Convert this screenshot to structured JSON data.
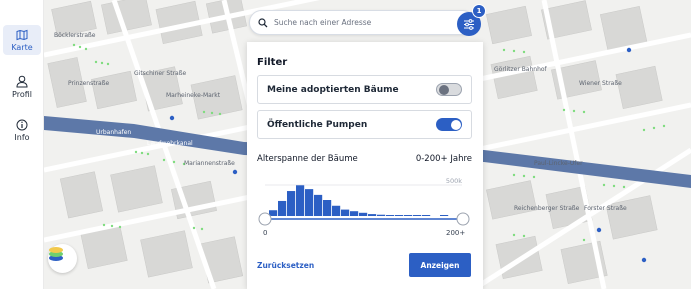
{
  "sidebar": {
    "items": [
      {
        "label": "Karte",
        "icon": "map-icon",
        "active": true
      },
      {
        "label": "Profil",
        "icon": "user-icon",
        "active": false
      },
      {
        "label": "Info",
        "icon": "info-icon",
        "active": false
      }
    ]
  },
  "search": {
    "placeholder": "Suche nach einer Adresse"
  },
  "filter_button": {
    "badge": "1"
  },
  "filter_panel": {
    "title": "Filter",
    "toggles": [
      {
        "label": "Meine adoptierten Bäume",
        "on": false
      },
      {
        "label": "Öffentliche Pumpen",
        "on": true
      }
    ],
    "age_label": "Alterspanne der Bäume",
    "age_range": "0-200+ Jahre",
    "histogram": {
      "max_label": "500k",
      "min_tick": "0",
      "max_tick": "200+",
      "bins": [
        0.18,
        0.47,
        0.78,
        0.96,
        0.84,
        0.66,
        0.5,
        0.32,
        0.2,
        0.15,
        0.1,
        0.06,
        0.04,
        0.03,
        0.02,
        0.02,
        0.01,
        0.02,
        0.0,
        0.01
      ]
    },
    "reset_label": "Zurücksetzen",
    "apply_label": "Anzeigen"
  },
  "map": {
    "labels": [
      "Gitschiner Straße",
      "Urbanhafen",
      "Landwehrkanal",
      "Prinzenstraße",
      "Marheineke-Markt",
      "Böcklerstraße",
      "Görlitzer Bahnhof",
      "Paul-Lincke-Ufer",
      "Wiener Straße",
      "Mariannenstraße",
      "Reichenberger Straße",
      "Forster Straße"
    ]
  },
  "colors": {
    "accent": "#2c5fc4",
    "canal": "#5d78a8",
    "tree": "#7fdc7f"
  }
}
